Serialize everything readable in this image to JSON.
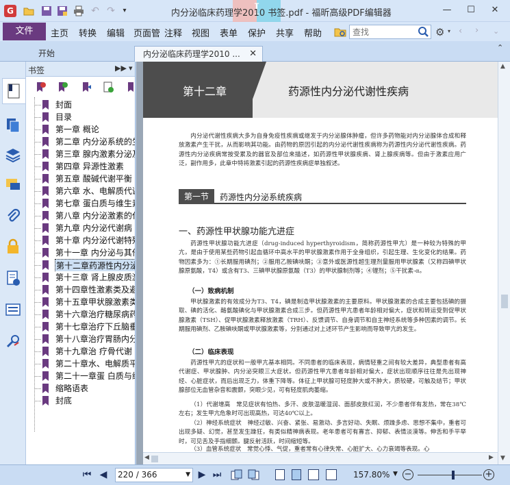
{
  "titlebar": {
    "title": "内分泌临床药理学2010 书签.pdf - 福昕高级PDF编辑器",
    "watermark_letter": "I"
  },
  "menubar": {
    "file": "文件",
    "items": [
      "主页",
      "转换",
      "编辑",
      "页面管",
      "注释",
      "视图",
      "表单",
      "保护",
      "共享",
      "帮助"
    ],
    "search_placeholder": "查找"
  },
  "tabs": {
    "home": "开始",
    "doc": "内分泌临床药理学2010 ..."
  },
  "bookmarks": {
    "header": "书签",
    "items": [
      "封面",
      "目录",
      "第一章 概论",
      "第二章 内分泌系统的生",
      "第三章 腺内激素分泌及",
      "第四章 异源性激素",
      "第五章 酸碱代谢平衡",
      "第六章 水、电解质代谢",
      "第七章 蛋白质与维生素",
      "第八章 内分泌激素的代",
      "第九章 内分泌代谢病",
      "第十章 内分泌代谢特殊",
      "第十一章 内分泌与其他",
      "第十二章药源性内分泌",
      "第十三章 肾上腺皮质激",
      "第十四章性激素类及避",
      "第十五章甲状腺激素类",
      "第十六章治疗糖尿病药",
      "第十七章治疗下丘脑垂",
      "第十八章治疗胃肠内分",
      "第十九章治 疗骨代谢",
      "第二十章水、电解质平",
      "第二十一章蛋 白质与维",
      "缩略语表",
      "封底"
    ],
    "selected_index": 13
  },
  "document": {
    "chapter_num": "第十二章",
    "chapter_title": "药源性内分泌代谢性疾病",
    "intro": "内分泌代谢性疾病大多为自身免疫性疾病或继发于内分泌腺体肿瘤，但许多药物能对内分泌腺体合成和释放激素产生干扰，从而影响其功能。由药物的原因引起的内分泌代谢性疾病称为药源性内分泌代谢性疾病。药源性内分泌疾病常按受累及的器官及部位来描述，如药源性甲状腺疾病、肾上腺疾病等。但由于激素应用广泛，副作用多，此章中特将激素引起的药源性疾病症单独叙述。",
    "section_tag": "第一节",
    "section_title": "药源性内分泌系统疾病",
    "h1": "一、药源性甲状腺功能亢进症",
    "p1": "药源性甲状腺功能亢进症（drug-induced hyperthyroidism，简称药源性甲亢）是一种较为特殊的甲亢，是由于使用某些药物引起血循环中高水平的甲状腺激素作用于全身组织，引起生理、生化变化的结果。药物因素多为：①长期服用碘剂；②服用乙胺碘呋酮；③意外或医源性超生理剂量服用甲状腺素（又称四碘甲状腺原氨酸，T4）或含有T3、三碘甲状腺原氨酸（T3）的甲状腺制剂等；④锂剂；⑤干扰素-α。",
    "h2a": "（一）致病机制",
    "p2": "甲状腺激素的有效成分为T3、T4，碘是制造甲状腺激素的主要原料。甲状腺激素的合成主要包括碘的摄取、碘的活化、酪氨酸碘化与甲状腺激素合成三步。但药源性甲亢患者年龄相对偏大，症状和转运受到促甲状腺激素（TSH）、促甲状腺激素释放激素（TRH）、反馈调节、自身调节和自主神经系统等多种因素的调节。长期服用碘剂、乙胺碘呋酮或甲状腺激素等，分别通过对上述环节产生影响而导致甲亢的发生。",
    "h2b": "（二）临床表现",
    "p3": "药源性甲亢的症状和一般甲亢基本相同。不同患者的临床表现，病情轻重之间有较大差异，典型患者有高代谢症、甲状腺肿、内分泌突眼三大症状。但药源性甲亢患者年龄相对偏大，症状出现顺序往往是先出现神经、心脏症状，而后出现乏力，体重下降等。体征上甲状腺可轻度肿大或不肿大，质较硬，可触及结节；甲状腺部位无血管杂音和震颤，突眼少见，可有轻度肌肉萎缩。",
    "p4": "（1）代谢增高　常见症状有怕热、多汗、皮肤温暖湿润、面部皮肤红润，不少患者伴有发热，常在38℃左右；发生甲亢危象时可出现高热，可达40℃以上。",
    "p5": "（2）神经系统症状　神经过敏、兴奋、紧张、易激动、多言好动、失眠、烦躁多虑、思想不集中，重者可出现多疑、幻觉，甚至发生躁狂，有类似精神病表现。老年患者可有寡言、抑郁、表情淡漠等。伸舌和手平举时，可见舌及手指细颤。腱反射活跃，时间缩短等。",
    "p6": "（3）血管系统症状　常觉心悸、气促，重者常有心律失常、心脏扩大、心力衰竭等表现。心"
  },
  "statusbar": {
    "page_display": "220 / 366",
    "zoom": "157.80%"
  }
}
